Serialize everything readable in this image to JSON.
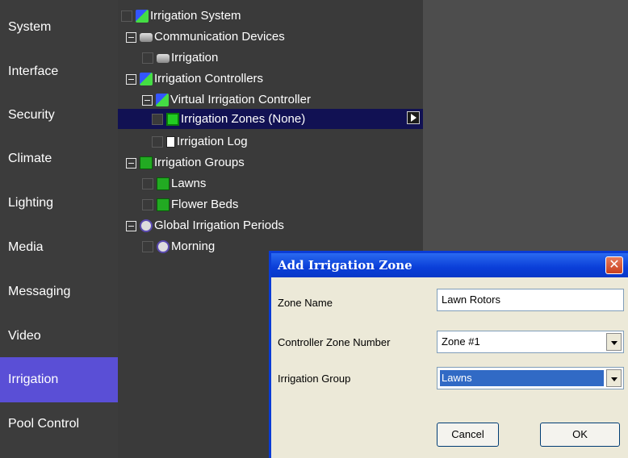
{
  "sidebar": {
    "items": [
      {
        "label": "System"
      },
      {
        "label": "Interface"
      },
      {
        "label": "Security"
      },
      {
        "label": "Climate"
      },
      {
        "label": "Lighting"
      },
      {
        "label": "Media"
      },
      {
        "label": "Messaging"
      },
      {
        "label": "Video"
      },
      {
        "label": "Irrigation"
      },
      {
        "label": "Pool Control"
      }
    ],
    "active": "Irrigation",
    "active_color": "#5a4fd6"
  },
  "tree": {
    "nodes": [
      {
        "label": "Irrigation System",
        "icon": "sprinkler-icon"
      },
      {
        "label": "Communication Devices",
        "icon": "device-icon"
      },
      {
        "label": "Irrigation",
        "icon": "device-icon"
      },
      {
        "label": "Irrigation Controllers",
        "icon": "sprinkler-icon"
      },
      {
        "label": "Virtual Irrigation Controller",
        "icon": "sprinkler-icon"
      },
      {
        "label": "Irrigation Zones (None)",
        "icon": "zone-icon"
      },
      {
        "label": "Irrigation Log",
        "icon": "log-icon"
      },
      {
        "label": "Irrigation Groups",
        "icon": "group-icon"
      },
      {
        "label": "Lawns",
        "icon": "group-icon"
      },
      {
        "label": "Flower Beds",
        "icon": "group-icon"
      },
      {
        "label": "Global Irrigation Periods",
        "icon": "clock-icon"
      },
      {
        "label": "Morning",
        "icon": "clock-icon"
      }
    ],
    "selected": "Irrigation Zones (None)"
  },
  "dialog": {
    "title": "Add Irrigation Zone",
    "zone_name_label": "Zone Name",
    "zone_name_value": "Lawn Rotors",
    "controller_zone_label": "Controller Zone Number",
    "controller_zone_value": "Zone #1",
    "group_label": "Irrigation Group",
    "group_value": "Lawns",
    "cancel_label": "Cancel",
    "ok_label": "OK",
    "close_glyph": "✕",
    "title_bar_color": "#0a3ed8"
  }
}
